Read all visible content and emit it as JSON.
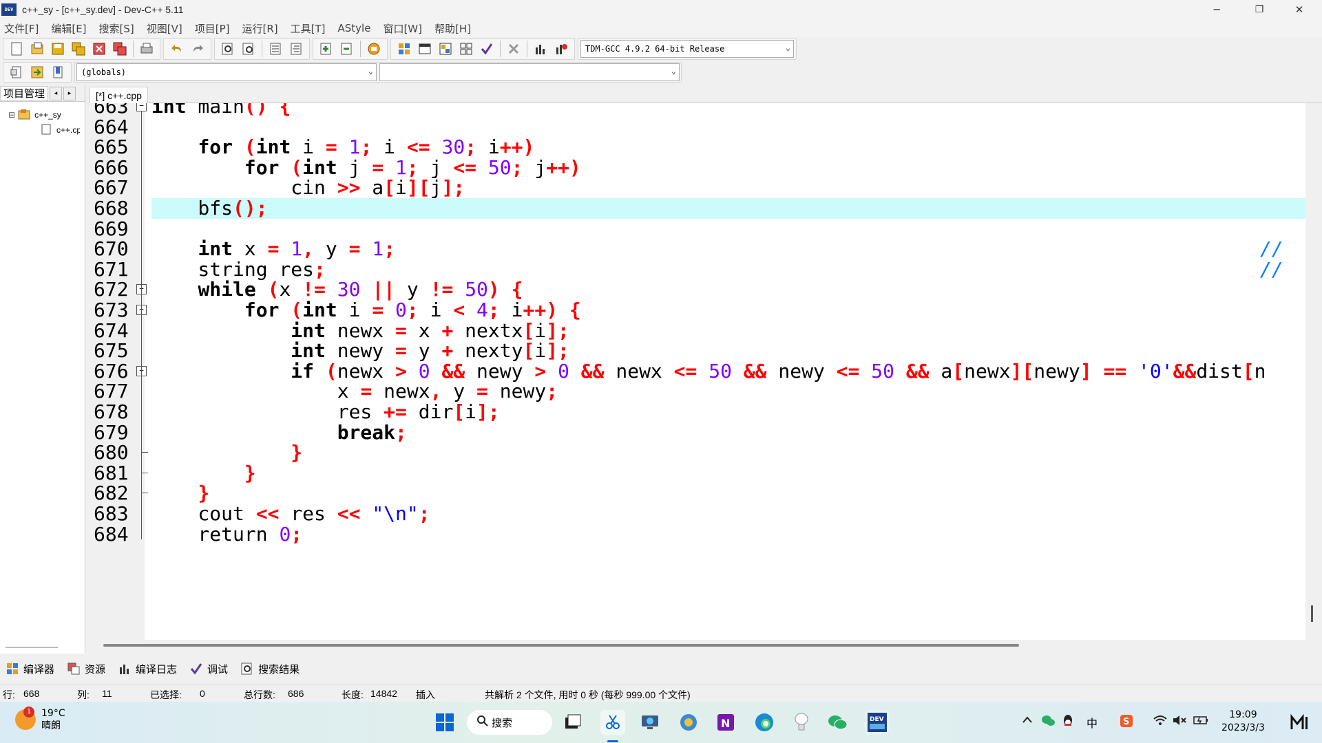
{
  "window": {
    "title": "c++_sy - [c++_sy.dev] - Dev-C++ 5.11",
    "app_icon": "DEV",
    "minimize": "─",
    "maximize": "❐",
    "close": "✕"
  },
  "menu": [
    "文件[F]",
    "编辑[E]",
    "搜索[S]",
    "视图[V]",
    "项目[P]",
    "运行[R]",
    "工具[T]",
    "AStyle",
    "窗口[W]",
    "帮助[H]"
  ],
  "toolbar": {
    "compiler_select": "TDM-GCC 4.9.2 64-bit Release",
    "scope_select": "(globals)",
    "function_select": ""
  },
  "project_panel": {
    "tab": "项目管理",
    "nav_left": "◂",
    "nav_right": "▸",
    "project": "c++_sy",
    "file": "c++.cpp",
    "expand": "⊟"
  },
  "editor": {
    "tab": "[*] c++.cpp",
    "lines": [
      {
        "n": "663",
        "fold": "box"
      },
      {
        "n": "664"
      },
      {
        "n": "665"
      },
      {
        "n": "666"
      },
      {
        "n": "667"
      },
      {
        "n": "668",
        "highlight": true
      },
      {
        "n": "669"
      },
      {
        "n": "670"
      },
      {
        "n": "671"
      },
      {
        "n": "672",
        "fold": "box"
      },
      {
        "n": "673",
        "fold": "box"
      },
      {
        "n": "674"
      },
      {
        "n": "675"
      },
      {
        "n": "676",
        "fold": "box"
      },
      {
        "n": "677"
      },
      {
        "n": "678"
      },
      {
        "n": "679"
      },
      {
        "n": "680",
        "fold": "end"
      },
      {
        "n": "681",
        "fold": "end"
      },
      {
        "n": "682",
        "fold": "end"
      },
      {
        "n": "683"
      },
      {
        "n": "684"
      }
    ]
  },
  "bottom_tabs": [
    "编译器",
    "资源",
    "编译日志",
    "调试",
    "搜索结果"
  ],
  "status": {
    "row_label": "行:",
    "row": "668",
    "col_label": "列:",
    "col": "11",
    "sel_label": "已选择:",
    "sel": "0",
    "total_label": "总行数:",
    "total": "686",
    "len_label": "长度:",
    "len": "14842",
    "mode": "插入",
    "msg": "共解析 2 个文件, 用时 0 秒 (每秒 999.00 个文件)"
  },
  "taskbar": {
    "weather_temp": "19°C",
    "weather_desc": "晴朗",
    "weather_badge": "1",
    "search": "搜索",
    "time": "19:09",
    "date": "2023/3/3",
    "ime": "中",
    "tray_icons": [
      "chevron-up-icon",
      "wechat-icon",
      "qq-icon",
      "ime-icon",
      "sogou-icon",
      "wifi-icon",
      "volume-icon",
      "battery-icon"
    ]
  },
  "colors": {
    "keyword": "#000000",
    "operator": "#ff0000",
    "number": "#8000ff",
    "string": "#0000ff",
    "comment": "#0080ff",
    "current_line": "#ccfbfb"
  }
}
